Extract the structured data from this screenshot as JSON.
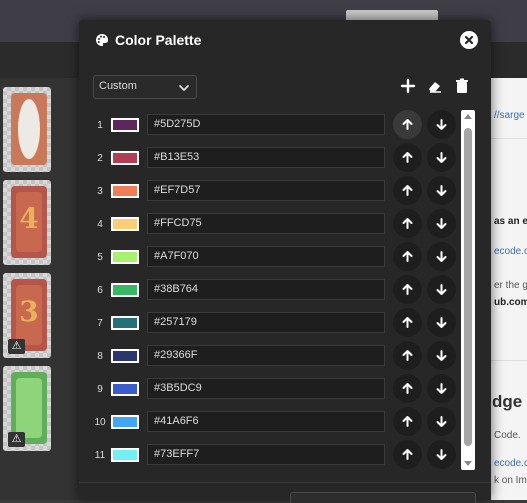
{
  "modal": {
    "title": "Color Palette",
    "palette_select": {
      "value": "Custom"
    },
    "toolbar": {
      "icons": [
        "plus-icon",
        "eraser-icon",
        "trash-icon"
      ]
    },
    "colors": [
      {
        "index": "1",
        "hex": "#5D275D"
      },
      {
        "index": "2",
        "hex": "#B13E53"
      },
      {
        "index": "3",
        "hex": "#EF7D57"
      },
      {
        "index": "4",
        "hex": "#FFCD75"
      },
      {
        "index": "5",
        "hex": "#A7F070"
      },
      {
        "index": "6",
        "hex": "#38B764"
      },
      {
        "index": "7",
        "hex": "#257179"
      },
      {
        "index": "8",
        "hex": "#29366F"
      },
      {
        "index": "9",
        "hex": "#3B5DC9"
      },
      {
        "index": "10",
        "hex": "#41A6F6"
      },
      {
        "index": "11",
        "hex": "#73EFF7"
      }
    ]
  },
  "background": {
    "fragments": [
      {
        "text": "//sarge",
        "style": "link"
      },
      {
        "text": "as an ex",
        "style": "bold"
      },
      {
        "text": "ecode.c",
        "style": "link"
      },
      {
        "text": "er the g",
        "style": "plain"
      },
      {
        "text": "ub.com/",
        "style": "link"
      },
      {
        "text": "dge",
        "style": "big"
      },
      {
        "text": "Code.",
        "style": "plain"
      },
      {
        "text": "ecode.c",
        "style": "link"
      },
      {
        "text": "k on Im",
        "style": "plain"
      }
    ],
    "thumbnails": [
      {
        "glyph": "",
        "warning": false
      },
      {
        "glyph": "4",
        "warning": false
      },
      {
        "glyph": "3",
        "warning": true
      },
      {
        "glyph": "",
        "warning": true
      }
    ],
    "warning_glyph": "⚠"
  }
}
